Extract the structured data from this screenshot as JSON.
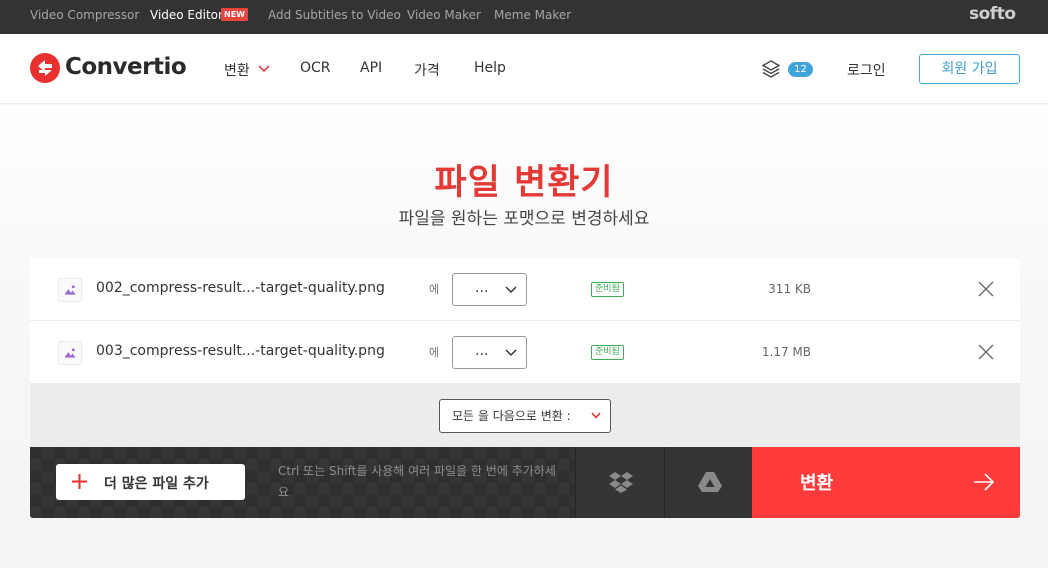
{
  "topbar": {
    "links": [
      {
        "label": "Video Compressor",
        "active": false
      },
      {
        "label": "Video Editor",
        "active": true
      },
      {
        "label": "Add Subtitles to Video",
        "active": false
      },
      {
        "label": "Video Maker",
        "active": false
      },
      {
        "label": "Meme Maker",
        "active": false
      }
    ],
    "new_badge": "NEW",
    "brand": "softo"
  },
  "header": {
    "logo_text": "Convertio",
    "nav": [
      {
        "label": "변환",
        "has_dropdown": true
      },
      {
        "label": "OCR"
      },
      {
        "label": "API"
      },
      {
        "label": "가격"
      },
      {
        "label": "Help"
      }
    ],
    "queue_count": "12",
    "login_label": "로그인",
    "signup_label": "회원 가입"
  },
  "hero": {
    "title": "파일 변환기",
    "subtitle": "파일을 원하는 포맷으로 변경하세요"
  },
  "files": [
    {
      "name": "002_compress-result...-target-quality.png",
      "to_label": "에",
      "format": "...",
      "status": "준비됨",
      "size": "311 KB"
    },
    {
      "name": "003_compress-result...-target-quality.png",
      "to_label": "에",
      "format": "...",
      "status": "준비됨",
      "size": "1.17 MB"
    }
  ],
  "convert_all": {
    "label": "모든 을 다음으로 변환 :"
  },
  "actions": {
    "add_files_label": "더 많은 파일 추가",
    "hint": "Ctrl 또는 Shift를 사용해 여러 파일을 한 번에 추가하세요",
    "convert_label": "변환"
  },
  "colors": {
    "accent_red": "#ff3b3b",
    "title_red": "#e53935",
    "status_green": "#3cae57",
    "link_blue": "#3d9dd0",
    "topbar_bg": "#333333"
  }
}
